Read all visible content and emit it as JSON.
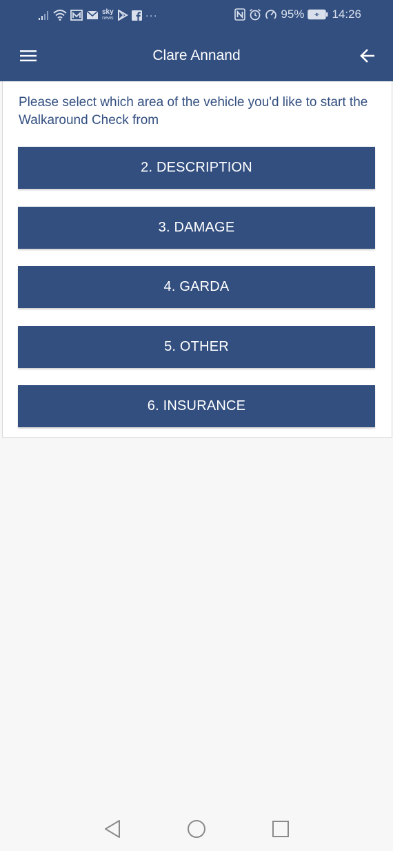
{
  "status_bar": {
    "sky_label": "sky",
    "sky_sub": "news",
    "more": "···",
    "nfc": "N",
    "battery_percent": "95%",
    "time": "14:26"
  },
  "app_bar": {
    "title": "Clare Annand"
  },
  "content": {
    "intro": "Please select which area of the vehicle you'd like to start the Walkaround Check from",
    "areas": [
      {
        "label": "2. DESCRIPTION"
      },
      {
        "label": "3. DAMAGE"
      },
      {
        "label": "4. GARDA"
      },
      {
        "label": "5. OTHER"
      },
      {
        "label": "6. INSURANCE"
      }
    ]
  },
  "colors": {
    "primary": "#334f80",
    "background": "#f7f7f7",
    "card": "#ffffff"
  }
}
